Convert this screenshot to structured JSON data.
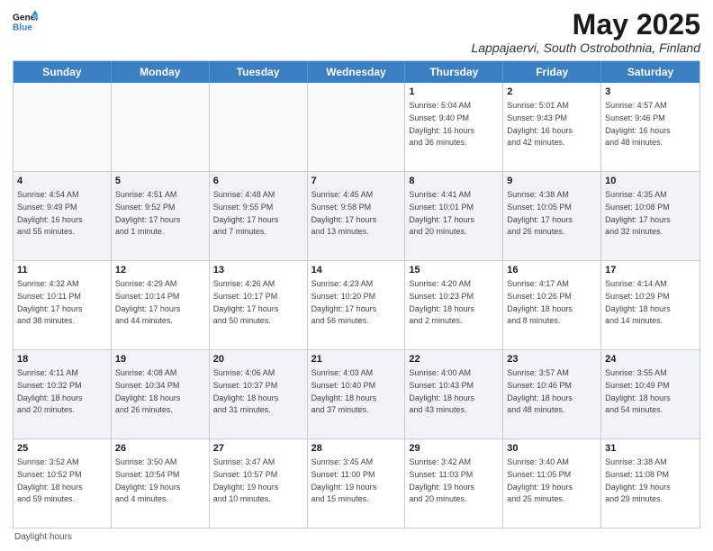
{
  "header": {
    "logo_line1": "General",
    "logo_line2": "Blue",
    "month_year": "May 2025",
    "location": "Lappajaervi, South Ostrobothnia, Finland"
  },
  "weekdays": [
    "Sunday",
    "Monday",
    "Tuesday",
    "Wednesday",
    "Thursday",
    "Friday",
    "Saturday"
  ],
  "weeks": [
    [
      {
        "day": "",
        "info": ""
      },
      {
        "day": "",
        "info": ""
      },
      {
        "day": "",
        "info": ""
      },
      {
        "day": "",
        "info": ""
      },
      {
        "day": "1",
        "info": "Sunrise: 5:04 AM\nSunset: 9:40 PM\nDaylight: 16 hours\nand 36 minutes."
      },
      {
        "day": "2",
        "info": "Sunrise: 5:01 AM\nSunset: 9:43 PM\nDaylight: 16 hours\nand 42 minutes."
      },
      {
        "day": "3",
        "info": "Sunrise: 4:57 AM\nSunset: 9:46 PM\nDaylight: 16 hours\nand 48 minutes."
      }
    ],
    [
      {
        "day": "4",
        "info": "Sunrise: 4:54 AM\nSunset: 9:49 PM\nDaylight: 16 hours\nand 55 minutes."
      },
      {
        "day": "5",
        "info": "Sunrise: 4:51 AM\nSunset: 9:52 PM\nDaylight: 17 hours\nand 1 minute."
      },
      {
        "day": "6",
        "info": "Sunrise: 4:48 AM\nSunset: 9:55 PM\nDaylight: 17 hours\nand 7 minutes."
      },
      {
        "day": "7",
        "info": "Sunrise: 4:45 AM\nSunset: 9:58 PM\nDaylight: 17 hours\nand 13 minutes."
      },
      {
        "day": "8",
        "info": "Sunrise: 4:41 AM\nSunset: 10:01 PM\nDaylight: 17 hours\nand 20 minutes."
      },
      {
        "day": "9",
        "info": "Sunrise: 4:38 AM\nSunset: 10:05 PM\nDaylight: 17 hours\nand 26 minutes."
      },
      {
        "day": "10",
        "info": "Sunrise: 4:35 AM\nSunset: 10:08 PM\nDaylight: 17 hours\nand 32 minutes."
      }
    ],
    [
      {
        "day": "11",
        "info": "Sunrise: 4:32 AM\nSunset: 10:11 PM\nDaylight: 17 hours\nand 38 minutes."
      },
      {
        "day": "12",
        "info": "Sunrise: 4:29 AM\nSunset: 10:14 PM\nDaylight: 17 hours\nand 44 minutes."
      },
      {
        "day": "13",
        "info": "Sunrise: 4:26 AM\nSunset: 10:17 PM\nDaylight: 17 hours\nand 50 minutes."
      },
      {
        "day": "14",
        "info": "Sunrise: 4:23 AM\nSunset: 10:20 PM\nDaylight: 17 hours\nand 56 minutes."
      },
      {
        "day": "15",
        "info": "Sunrise: 4:20 AM\nSunset: 10:23 PM\nDaylight: 18 hours\nand 2 minutes."
      },
      {
        "day": "16",
        "info": "Sunrise: 4:17 AM\nSunset: 10:26 PM\nDaylight: 18 hours\nand 8 minutes."
      },
      {
        "day": "17",
        "info": "Sunrise: 4:14 AM\nSunset: 10:29 PM\nDaylight: 18 hours\nand 14 minutes."
      }
    ],
    [
      {
        "day": "18",
        "info": "Sunrise: 4:11 AM\nSunset: 10:32 PM\nDaylight: 18 hours\nand 20 minutes."
      },
      {
        "day": "19",
        "info": "Sunrise: 4:08 AM\nSunset: 10:34 PM\nDaylight: 18 hours\nand 26 minutes."
      },
      {
        "day": "20",
        "info": "Sunrise: 4:06 AM\nSunset: 10:37 PM\nDaylight: 18 hours\nand 31 minutes."
      },
      {
        "day": "21",
        "info": "Sunrise: 4:03 AM\nSunset: 10:40 PM\nDaylight: 18 hours\nand 37 minutes."
      },
      {
        "day": "22",
        "info": "Sunrise: 4:00 AM\nSunset: 10:43 PM\nDaylight: 18 hours\nand 43 minutes."
      },
      {
        "day": "23",
        "info": "Sunrise: 3:57 AM\nSunset: 10:46 PM\nDaylight: 18 hours\nand 48 minutes."
      },
      {
        "day": "24",
        "info": "Sunrise: 3:55 AM\nSunset: 10:49 PM\nDaylight: 18 hours\nand 54 minutes."
      }
    ],
    [
      {
        "day": "25",
        "info": "Sunrise: 3:52 AM\nSunset: 10:52 PM\nDaylight: 18 hours\nand 59 minutes."
      },
      {
        "day": "26",
        "info": "Sunrise: 3:50 AM\nSunset: 10:54 PM\nDaylight: 19 hours\nand 4 minutes."
      },
      {
        "day": "27",
        "info": "Sunrise: 3:47 AM\nSunset: 10:57 PM\nDaylight: 19 hours\nand 10 minutes."
      },
      {
        "day": "28",
        "info": "Sunrise: 3:45 AM\nSunset: 11:00 PM\nDaylight: 19 hours\nand 15 minutes."
      },
      {
        "day": "29",
        "info": "Sunrise: 3:42 AM\nSunset: 11:03 PM\nDaylight: 19 hours\nand 20 minutes."
      },
      {
        "day": "30",
        "info": "Sunrise: 3:40 AM\nSunset: 11:05 PM\nDaylight: 19 hours\nand 25 minutes."
      },
      {
        "day": "31",
        "info": "Sunrise: 3:38 AM\nSunset: 11:08 PM\nDaylight: 19 hours\nand 29 minutes."
      }
    ]
  ],
  "footer": "Daylight hours"
}
